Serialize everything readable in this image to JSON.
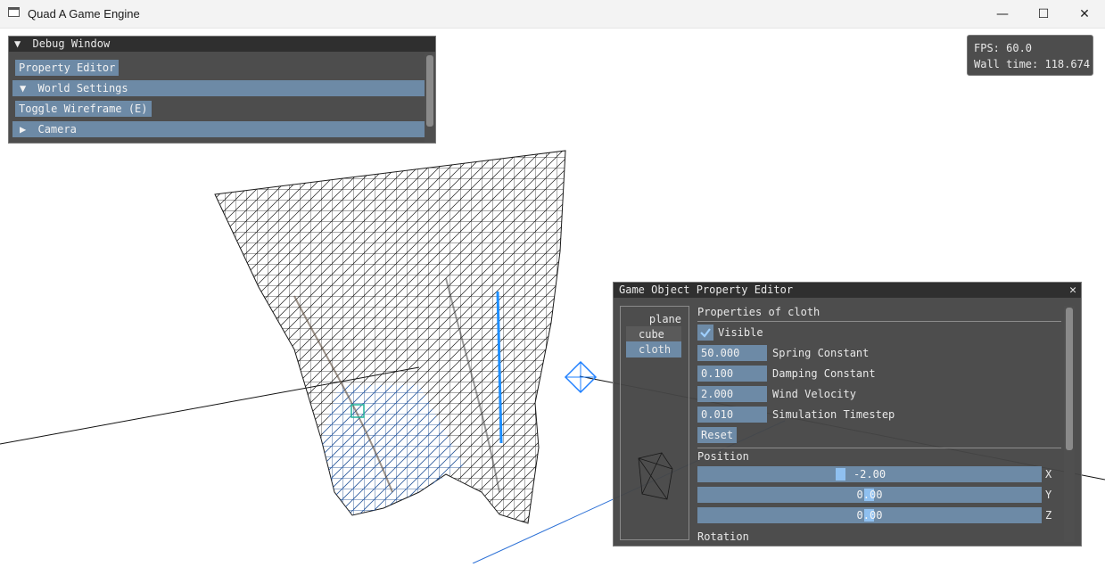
{
  "window": {
    "title": "Quad A Game Engine",
    "minimize": "—",
    "maximize": "☐",
    "close": "✕"
  },
  "stats": {
    "fps": "FPS: 60.0",
    "wall_time": "Wall time: 118.674"
  },
  "debug_window": {
    "title": "Debug Window",
    "collapse_glyph": "▼",
    "property_editor_button": "Property Editor",
    "world_settings": {
      "glyph": "▼",
      "label": "World Settings"
    },
    "toggle_wireframe_button": "Toggle Wireframe (E)",
    "camera": {
      "glyph": "▶",
      "label": "Camera"
    }
  },
  "property_editor": {
    "title": "Game Object Property Editor",
    "close": "✕",
    "objects": [
      "plane",
      "cube",
      "cloth"
    ],
    "selected_object": "cloth",
    "heading": "Properties of cloth",
    "visible_label": "Visible",
    "visible_checked": true,
    "params": [
      {
        "value": "50.000",
        "label": "Spring Constant"
      },
      {
        "value": "0.100",
        "label": "Damping Constant"
      },
      {
        "value": "2.000",
        "label": "Wind Velocity"
      },
      {
        "value": "0.010",
        "label": "Simulation Timestep"
      }
    ],
    "reset_button": "Reset",
    "position_heading": "Position",
    "position": [
      {
        "axis": "X",
        "value": "-2.00"
      },
      {
        "axis": "Y",
        "value": "0.00"
      },
      {
        "axis": "Z",
        "value": "0.00"
      }
    ],
    "rotation_heading": "Rotation"
  },
  "colors": {
    "panel_bg": "#464646",
    "title_bg": "#2f2f2f",
    "accent": "#6d8aa6",
    "grab": "#8fc0f0",
    "mesh": "#1a1a1a",
    "mesh_blue": "#2a6fd6"
  }
}
